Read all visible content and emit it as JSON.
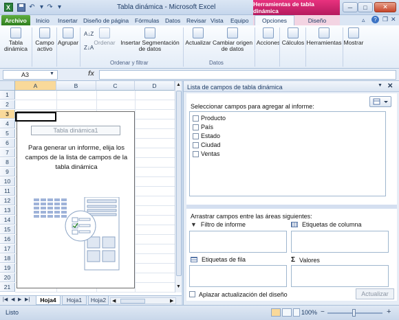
{
  "window": {
    "title": "Tabla dinámica - Microsoft Excel",
    "context_header": "Herramientas de tabla dinámica",
    "controls": {
      "minimize": "─",
      "maximize": "□",
      "close": "✕"
    }
  },
  "tabs": {
    "file": "Archivo",
    "items": [
      "Inicio",
      "Insertar",
      "Diseño de página",
      "Fórmulas",
      "Datos",
      "Revisar",
      "Vista",
      "Equipo"
    ],
    "context_items": [
      "Opciones",
      "Diseño"
    ]
  },
  "ribbon": {
    "buttons": {
      "pivot_table": "Tabla dinámica",
      "active_field": "Campo activo",
      "group": "Agrupar",
      "sort": "Ordenar",
      "insert_slicer": "Insertar Segmentación de datos",
      "refresh": "Actualizar",
      "change_source": "Cambiar origen de datos",
      "actions": "Acciones",
      "calculations": "Cálculos",
      "tools": "Herramientas",
      "show": "Mostrar"
    },
    "groups": {
      "sort_filter": "Ordenar y filtrar",
      "data": "Datos"
    }
  },
  "formula_bar": {
    "name_box": "A3",
    "fx": "fx",
    "value": ""
  },
  "sheet": {
    "columns": [
      "A",
      "B",
      "C",
      "D"
    ],
    "rows": [
      "1",
      "2",
      "3",
      "4",
      "5",
      "6",
      "7",
      "8",
      "9",
      "10",
      "11",
      "12",
      "13",
      "14",
      "15",
      "16",
      "17",
      "18",
      "19",
      "20",
      "21"
    ],
    "pivot_placeholder": {
      "title": "Tabla dinámica1",
      "message": "Para generar un informe, elija los campos de la lista de campos de la tabla dinámica"
    },
    "tabs": [
      "Hoja4",
      "Hoja1",
      "Hoja2"
    ]
  },
  "field_list": {
    "title": "Lista de campos de tabla dinámica",
    "select_label": "Seleccionar campos para agregar al informe:",
    "fields": [
      "Producto",
      "País",
      "Estado",
      "Ciudad",
      "Ventas"
    ],
    "drag_label": "Arrastrar campos entre las áreas siguientes:",
    "areas": {
      "report_filter": "Filtro de informe",
      "column_labels": "Etiquetas de columna",
      "row_labels": "Etiquetas de fila",
      "values": "Valores"
    },
    "defer_label": "Aplazar actualización del diseño",
    "update_button": "Actualizar"
  },
  "status": {
    "text": "Listo",
    "zoom": "100%"
  }
}
